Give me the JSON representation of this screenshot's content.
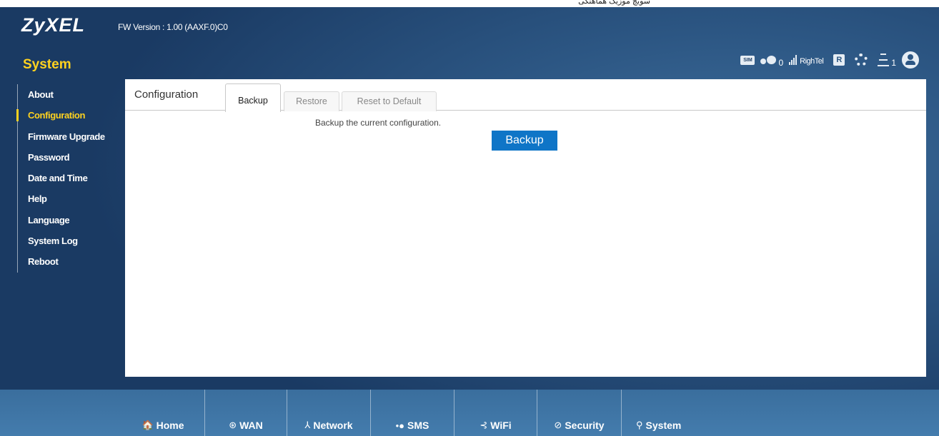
{
  "app": {
    "top_strip": "ﺳﻮﯾﭻ ﻣﻮﺯﯾﮏ ﻫﻤﺎﻫﻨﮕﯽ",
    "logo": "ZyXEL",
    "firmware": "FW Version : 1.00 (AAXF.0)C0",
    "section_title": "System"
  },
  "status": {
    "sim_label": "SIM",
    "sms_count": "0",
    "operator": "RighTel",
    "roaming_label": "R",
    "wifi_clients": "1",
    "icons": [
      "sim-icon",
      "sms-icon",
      "signal-icon",
      "roaming-icon",
      "gear-icon",
      "wifi-clients-icon",
      "user-icon"
    ]
  },
  "sidebar": {
    "items": [
      {
        "label": "About"
      },
      {
        "label": "Configuration",
        "active": true
      },
      {
        "label": "Firmware Upgrade"
      },
      {
        "label": "Password"
      },
      {
        "label": "Date and Time"
      },
      {
        "label": "Help"
      },
      {
        "label": "Language"
      },
      {
        "label": "System Log"
      },
      {
        "label": "Reboot"
      }
    ]
  },
  "panel": {
    "heading": "Configuration",
    "tabs": [
      {
        "label": "Backup",
        "active": true
      },
      {
        "label": "Restore"
      },
      {
        "label": "Reset to Default"
      }
    ],
    "description": "Backup the current configuration.",
    "button_label": "Backup"
  },
  "bottom_nav": {
    "items": [
      {
        "label": "Home",
        "icon": "home-icon",
        "glyph": "🏠"
      },
      {
        "label": "WAN",
        "icon": "globe-icon",
        "glyph": "⊛"
      },
      {
        "label": "Network",
        "icon": "network-icon",
        "glyph": "⅄"
      },
      {
        "label": "SMS",
        "icon": "sms-icon",
        "glyph": "•●"
      },
      {
        "label": "WiFi",
        "icon": "wifi-icon",
        "glyph": "⊰"
      },
      {
        "label": "Security",
        "icon": "shield-icon",
        "glyph": "⊘"
      },
      {
        "label": "System",
        "icon": "system-icon",
        "glyph": "⚲"
      }
    ]
  },
  "colors": {
    "accent": "#ffd21f",
    "button": "#0f75c7",
    "background": "#2c5683"
  }
}
